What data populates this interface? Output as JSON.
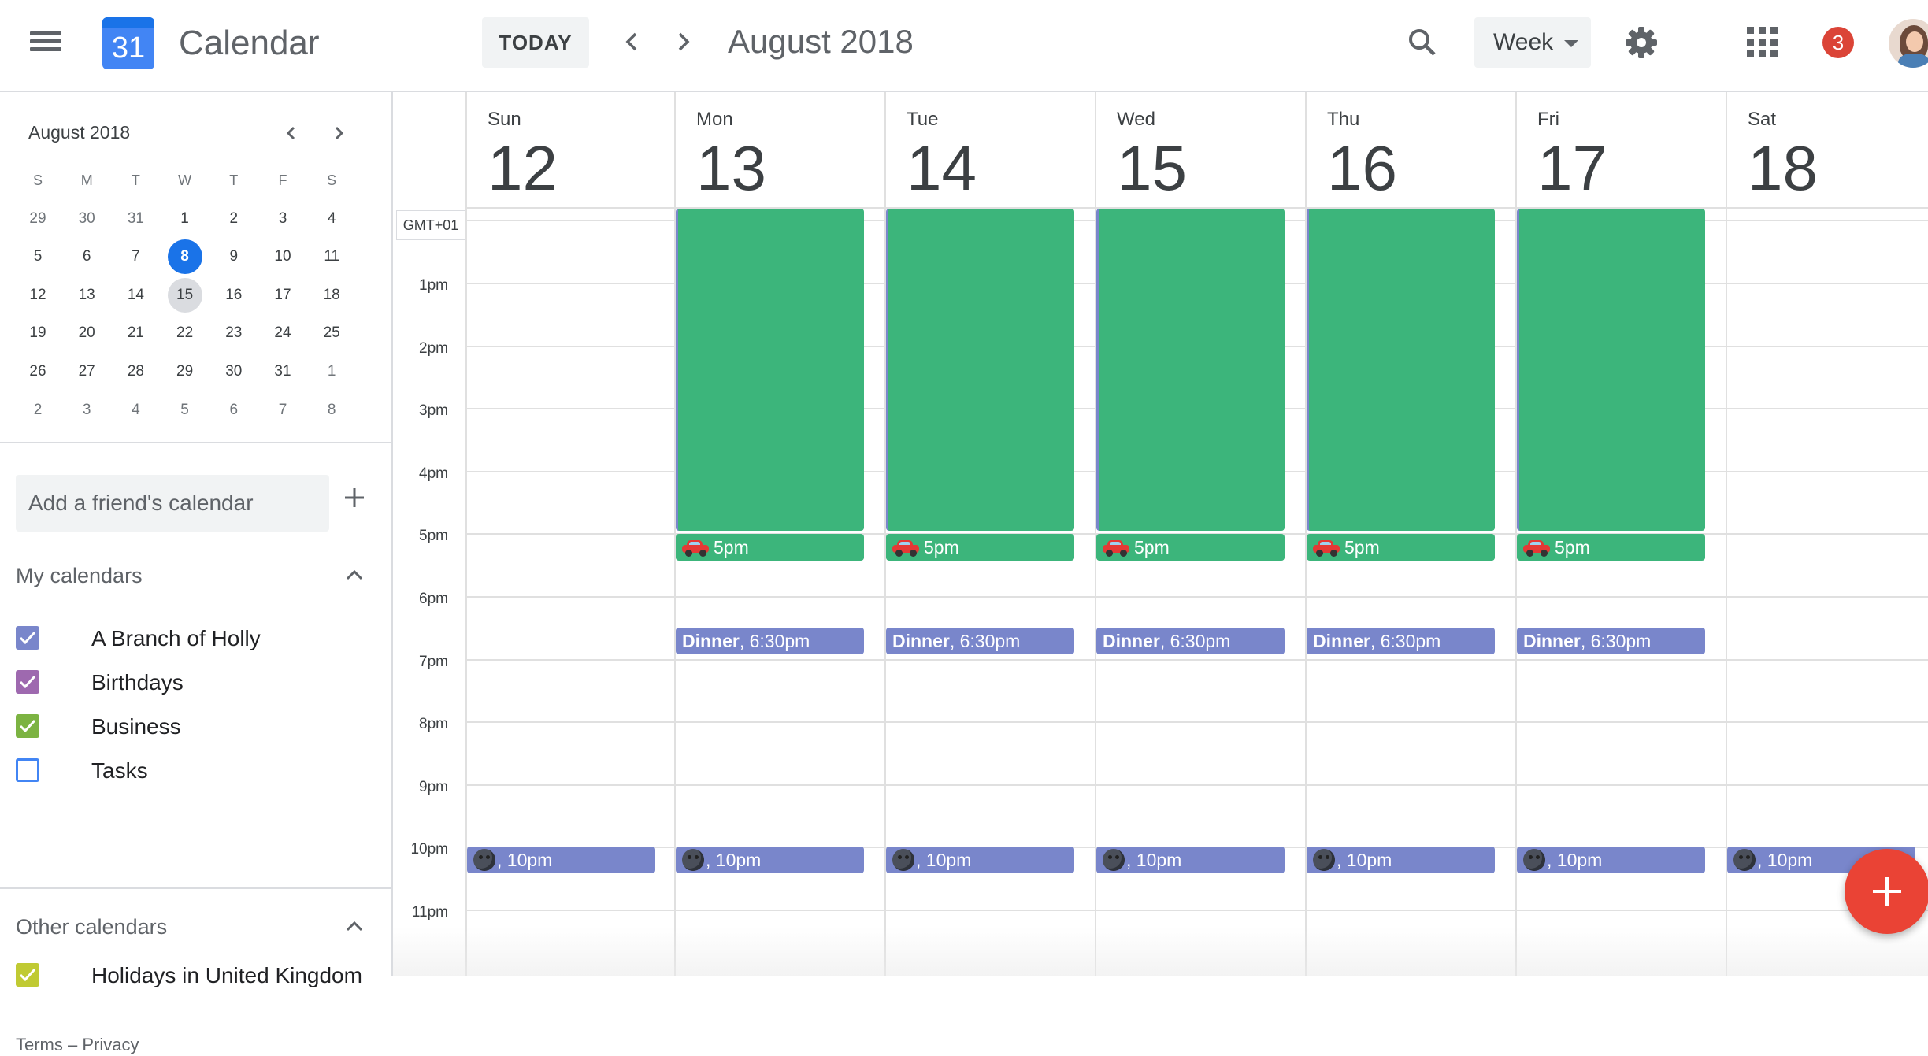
{
  "app": {
    "title": "Calendar",
    "logo_number": "31"
  },
  "toolbar": {
    "today_label": "TODAY",
    "period_title": "August 2018",
    "view_label": "Week",
    "notification_count": "3"
  },
  "mini_calendar": {
    "title": "August 2018",
    "weekday_headers": [
      "S",
      "M",
      "T",
      "W",
      "T",
      "F",
      "S"
    ],
    "weeks": [
      [
        "29",
        "30",
        "31",
        "1",
        "2",
        "3",
        "4"
      ],
      [
        "5",
        "6",
        "7",
        "8",
        "9",
        "10",
        "11"
      ],
      [
        "12",
        "13",
        "14",
        "15",
        "16",
        "17",
        "18"
      ],
      [
        "19",
        "20",
        "21",
        "22",
        "23",
        "24",
        "25"
      ],
      [
        "26",
        "27",
        "28",
        "29",
        "30",
        "31",
        "1"
      ],
      [
        "2",
        "3",
        "4",
        "5",
        "6",
        "7",
        "8"
      ]
    ],
    "selected_date": "8",
    "highlighted_date": "15"
  },
  "sidebar": {
    "friend_placeholder": "Add a friend's calendar",
    "my_calendars_label": "My calendars",
    "my_calendars": [
      {
        "label": "A Branch of Holly",
        "checked": true,
        "color": "#7986cb"
      },
      {
        "label": "Birthdays",
        "checked": true,
        "color": "#9e69af"
      },
      {
        "label": "Business",
        "checked": true,
        "color": "#7cb342"
      },
      {
        "label": "Tasks",
        "checked": false,
        "color": "#4285f4"
      }
    ],
    "other_calendars_label": "Other calendars",
    "other_calendars": [
      {
        "label": "Holidays in United Kingdom",
        "checked": true,
        "color": "#c0ca33"
      }
    ],
    "footer": "Terms – Privacy"
  },
  "week": {
    "timezone": "GMT+01",
    "days": [
      {
        "name": "Sun",
        "date": "12"
      },
      {
        "name": "Mon",
        "date": "13"
      },
      {
        "name": "Tue",
        "date": "14"
      },
      {
        "name": "Wed",
        "date": "15"
      },
      {
        "name": "Thu",
        "date": "16"
      },
      {
        "name": "Fri",
        "date": "17"
      },
      {
        "name": "Sat",
        "date": "18"
      }
    ],
    "hours": [
      "1pm",
      "2pm",
      "3pm",
      "4pm",
      "5pm",
      "6pm",
      "7pm",
      "8pm",
      "9pm",
      "10pm",
      "11pm"
    ]
  },
  "events": {
    "commute_time": "5pm",
    "dinner_title": "Dinner",
    "dinner_time": ", 6:30pm",
    "night_time": ", 10pm"
  },
  "colors": {
    "accent_blue": "#1a73e8",
    "event_green": "#3cb57b",
    "event_lavender": "#7986cb",
    "fab_red": "#ea4335",
    "badge_red": "#db4437"
  }
}
